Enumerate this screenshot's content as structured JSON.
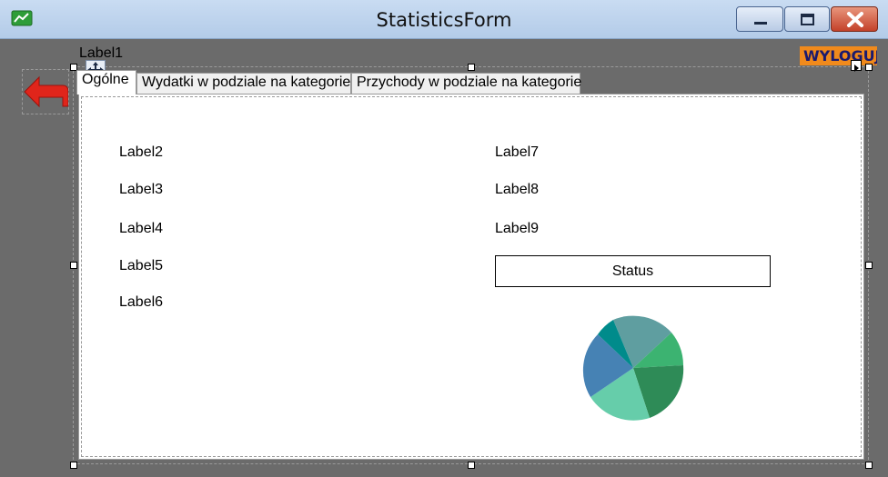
{
  "window": {
    "title": "StatisticsForm"
  },
  "form": {
    "label1": "Label1",
    "logout_label": "WYLOGUJ",
    "tabs": [
      {
        "label": "Ogólne",
        "active": true
      },
      {
        "label": "Wydatki w podziale na kategorie",
        "active": false
      },
      {
        "label": "Przychody w podziale na kategorie",
        "active": false
      }
    ],
    "left_labels": [
      "Label2",
      "Label3",
      "Label4",
      "Label5",
      "Label6"
    ],
    "right_labels": [
      "Label7",
      "Label8",
      "Label9"
    ],
    "status_text": "Status"
  },
  "icons": {
    "app": "chart-icon",
    "back": "back-arrow-icon",
    "move": "move-icon",
    "smart_tag": "smart-tag-icon"
  },
  "colors": {
    "logout_bg": "#f08a1c",
    "back_arrow": "#e0251b",
    "pie": [
      "#5f9ea0",
      "#3cb371",
      "#2e8b57",
      "#66cdaa",
      "#4682b4",
      "#008b8b"
    ]
  }
}
